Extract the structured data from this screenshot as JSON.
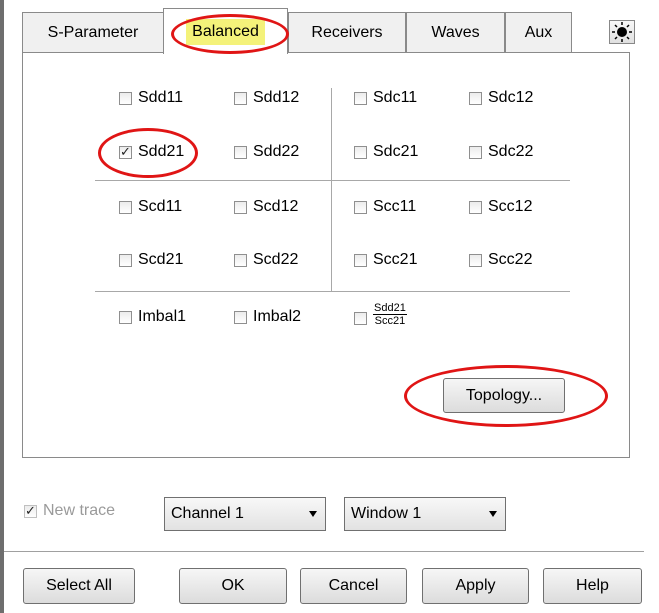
{
  "tabs": [
    {
      "label": "S-Parameter"
    },
    {
      "label": "Balanced"
    },
    {
      "label": "Receivers"
    },
    {
      "label": "Waves"
    },
    {
      "label": "Aux"
    }
  ],
  "settings_icon": "sun-icon",
  "params": {
    "sdd11": {
      "label": "Sdd11",
      "checked": false
    },
    "sdd12": {
      "label": "Sdd12",
      "checked": false
    },
    "sdc11": {
      "label": "Sdc11",
      "checked": false
    },
    "sdc12": {
      "label": "Sdc12",
      "checked": false
    },
    "sdd21": {
      "label": "Sdd21",
      "checked": true
    },
    "sdd22": {
      "label": "Sdd22",
      "checked": false
    },
    "sdc21": {
      "label": "Sdc21",
      "checked": false
    },
    "sdc22": {
      "label": "Sdc22",
      "checked": false
    },
    "scd11": {
      "label": "Scd11",
      "checked": false
    },
    "scd12": {
      "label": "Scd12",
      "checked": false
    },
    "scc11": {
      "label": "Scc11",
      "checked": false
    },
    "scc12": {
      "label": "Scc12",
      "checked": false
    },
    "scd21": {
      "label": "Scd21",
      "checked": false
    },
    "scd22": {
      "label": "Scd22",
      "checked": false
    },
    "scc21": {
      "label": "Scc21",
      "checked": false
    },
    "scc22": {
      "label": "Scc22",
      "checked": false
    },
    "imbal1": {
      "label": "Imbal1",
      "checked": false
    },
    "imbal2": {
      "label": "Imbal2",
      "checked": false
    },
    "cmrr": {
      "numerator": "Sdd21",
      "denominator": "Scc21",
      "checked": false
    }
  },
  "topology_button": "Topology...",
  "new_trace": {
    "label": "New trace",
    "checked": true,
    "disabled": true
  },
  "channel_select": {
    "value": "Channel 1"
  },
  "window_select": {
    "value": "Window 1"
  },
  "buttons": {
    "select_all": "Select All",
    "ok": "OK",
    "cancel": "Cancel",
    "apply": "Apply",
    "help": "Help"
  },
  "colors": {
    "highlight": "#f4f27a",
    "annotation": "#e01515"
  }
}
